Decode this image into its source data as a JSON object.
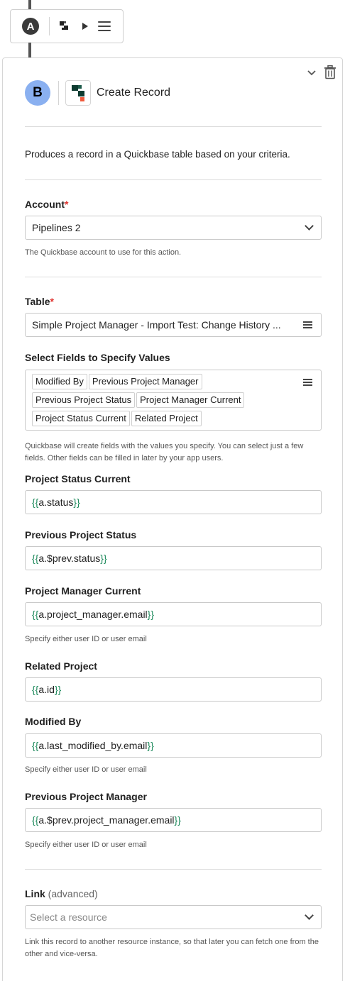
{
  "step_a": {
    "badge": "A"
  },
  "step_b": {
    "badge": "B",
    "title": "Create Record",
    "description": "Produces a record in a Quickbase table based on your criteria."
  },
  "account": {
    "label": "Account",
    "required_mark": "*",
    "value": "Pipelines 2",
    "help": "The Quickbase account to use for this action."
  },
  "table": {
    "label": "Table",
    "required_mark": "*",
    "value": "Simple Project Manager - Import Test: Change History ..."
  },
  "select_fields": {
    "label": "Select Fields to Specify Values",
    "chips": [
      "Modified By",
      "Previous Project Manager",
      "Previous Project Status",
      "Project Manager Current",
      "Project Status Current",
      "Related Project"
    ],
    "help": "Quickbase will create fields with the values you specify. You can select just a few fields. Other fields can be filled in later by your app users."
  },
  "fields": {
    "project_status_current": {
      "label": "Project Status Current",
      "value": "a.status"
    },
    "previous_project_status": {
      "label": "Previous Project Status",
      "value": "a.$prev.status"
    },
    "project_manager_current": {
      "label": "Project Manager Current",
      "value": "a.project_manager.email",
      "help": "Specify either user ID or user email"
    },
    "related_project": {
      "label": "Related Project",
      "value": "a.id"
    },
    "modified_by": {
      "label": "Modified By",
      "value": "a.last_modified_by.email",
      "help": "Specify either user ID or user email"
    },
    "previous_project_manager": {
      "label": "Previous Project Manager",
      "value": "a.$prev.project_manager.email",
      "help": "Specify either user ID or user email"
    }
  },
  "link": {
    "label": "Link",
    "label_suffix": "(advanced)",
    "placeholder": "Select a resource",
    "help": "Link this record to another resource instance, so that later you can fetch one from the other and vice-versa."
  },
  "colors": {
    "accent_badge": "#8ab0f0",
    "template_brace": "#1e8a5c",
    "required": "#e0332f"
  }
}
